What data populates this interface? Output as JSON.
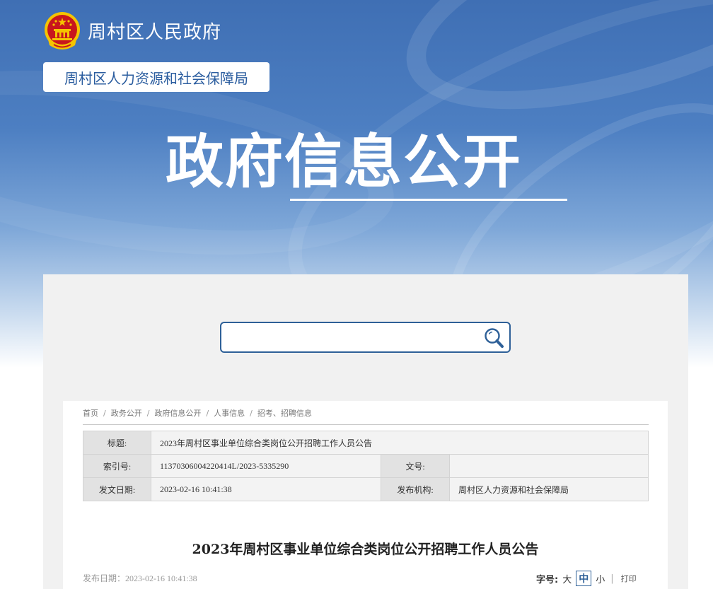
{
  "header": {
    "site_name": "周村区人民政府",
    "department": "周村区人力资源和社会保障局",
    "banner_title": "政府信息公开"
  },
  "search": {
    "value": "",
    "placeholder": ""
  },
  "breadcrumb": [
    "首页",
    "政务公开",
    "政府信息公开",
    "人事信息",
    "招考、招聘信息"
  ],
  "meta": {
    "title_label": "标题:",
    "title_value": "2023年周村区事业单位综合类岗位公开招聘工作人员公告",
    "index_label": "索引号:",
    "index_value": "11370306004220414L/2023-5335290",
    "docno_label": "文号:",
    "docno_value": "",
    "date_label": "发文日期:",
    "date_value": "2023-02-16 10:41:38",
    "org_label": "发布机构:",
    "org_value": "周村区人力资源和社会保障局"
  },
  "article": {
    "title": "2023年周村区事业单位综合类岗位公开招聘工作人员公告",
    "publish_date": "发布日期：2023-02-16 10:41:38"
  },
  "font_size": {
    "label": "字号:",
    "large": "大",
    "medium": "中",
    "small": "小",
    "separator": "|",
    "print": "打印",
    "selected": "中"
  },
  "colors": {
    "accent": "#2e6098",
    "emblem_red": "#c8161d",
    "emblem_gold": "#f5c400"
  }
}
